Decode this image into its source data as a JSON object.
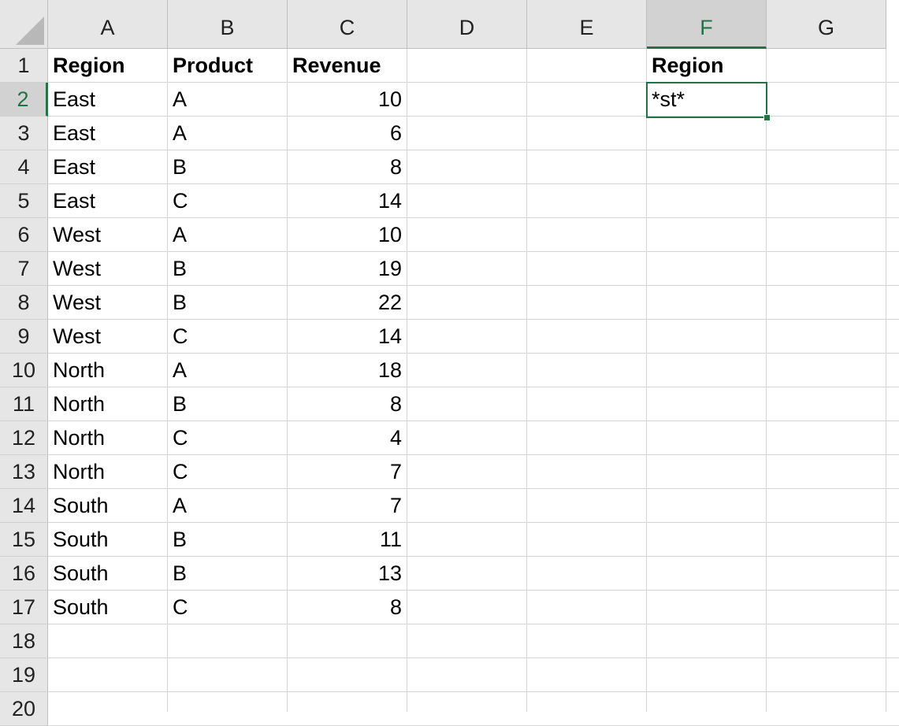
{
  "columns": [
    "A",
    "B",
    "C",
    "D",
    "E",
    "F",
    "G"
  ],
  "selected_column": "F",
  "selected_row": "2",
  "rows": [
    "1",
    "2",
    "3",
    "4",
    "5",
    "6",
    "7",
    "8",
    "9",
    "10",
    "11",
    "12",
    "13",
    "14",
    "15",
    "16",
    "17",
    "18",
    "19",
    "20"
  ],
  "table": {
    "headers": {
      "region": "Region",
      "product": "Product",
      "revenue": "Revenue"
    },
    "records": [
      {
        "region": "East",
        "product": "A",
        "revenue": "10"
      },
      {
        "region": "East",
        "product": "A",
        "revenue": "6"
      },
      {
        "region": "East",
        "product": "B",
        "revenue": "8"
      },
      {
        "region": "East",
        "product": "C",
        "revenue": "14"
      },
      {
        "region": "West",
        "product": "A",
        "revenue": "10"
      },
      {
        "region": "West",
        "product": "B",
        "revenue": "19"
      },
      {
        "region": "West",
        "product": "B",
        "revenue": "22"
      },
      {
        "region": "West",
        "product": "C",
        "revenue": "14"
      },
      {
        "region": "North",
        "product": "A",
        "revenue": "18"
      },
      {
        "region": "North",
        "product": "B",
        "revenue": "8"
      },
      {
        "region": "North",
        "product": "C",
        "revenue": "4"
      },
      {
        "region": "North",
        "product": "C",
        "revenue": "7"
      },
      {
        "region": "South",
        "product": "A",
        "revenue": "7"
      },
      {
        "region": "South",
        "product": "B",
        "revenue": "11"
      },
      {
        "region": "South",
        "product": "B",
        "revenue": "13"
      },
      {
        "region": "South",
        "product": "C",
        "revenue": "8"
      }
    ]
  },
  "criteria": {
    "header": "Region",
    "value": "*st*"
  },
  "colors": {
    "accent": "#217346",
    "header_bg": "#e6e6e6",
    "grid": "#d4d4d4"
  }
}
